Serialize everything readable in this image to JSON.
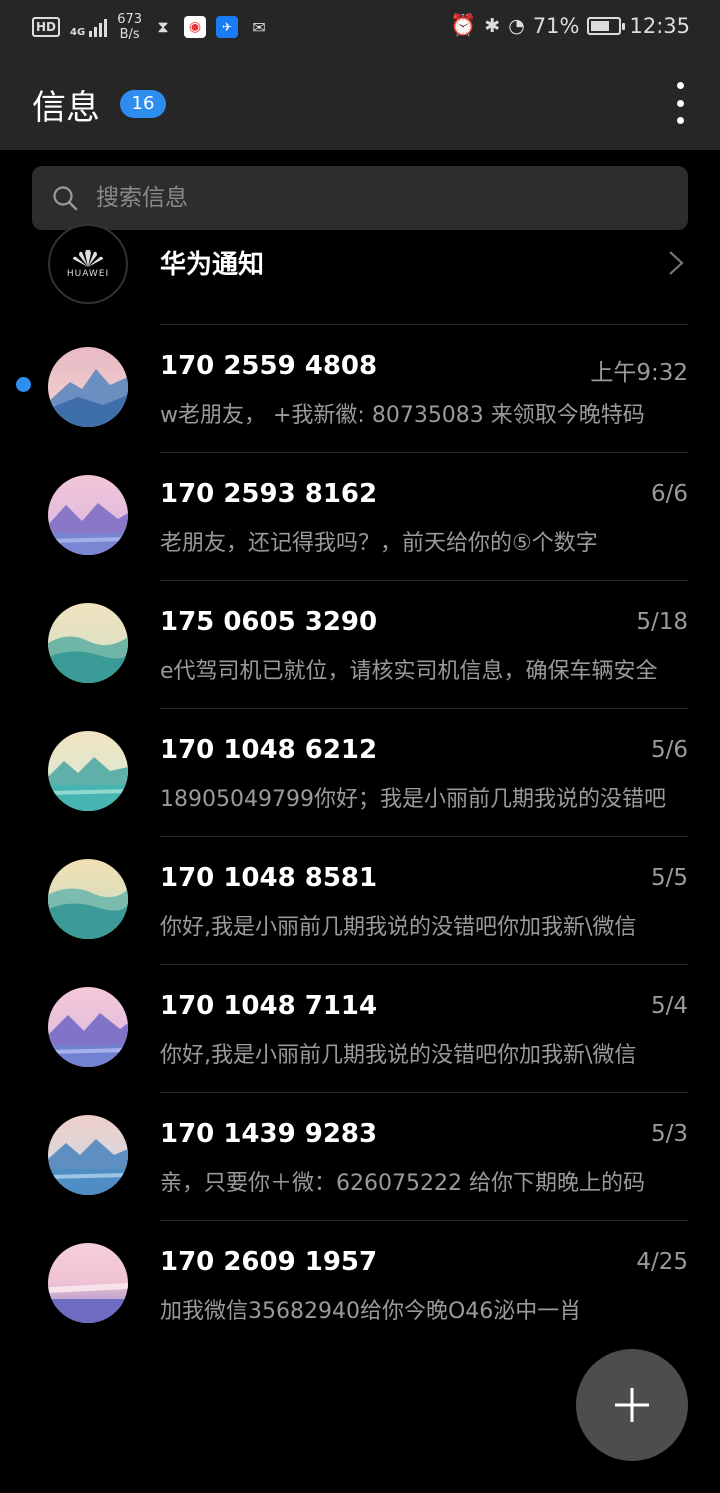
{
  "status_bar": {
    "hd": "HD",
    "network": "4G",
    "speed_value": "673",
    "speed_unit": "B/s",
    "battery": "71%",
    "battery_level": 0.71,
    "time": "12:35"
  },
  "header": {
    "title": "信息",
    "unread_count": "16",
    "more_icon": "more-vertical-icon"
  },
  "search": {
    "placeholder": "搜索信息"
  },
  "notification": {
    "logo_text": "HUAWEI",
    "title": "华为通知"
  },
  "conversations": [
    {
      "sender": "170 2559 4808",
      "time": "上午9:32",
      "preview": "w老朋友， +我新徽:  80735083 来领取今晚特码",
      "unread": true,
      "avatar": "mountain-pink"
    },
    {
      "sender": "170 2593 8162",
      "time": "6/6",
      "preview": "老朋友，还记得我吗？，前天给你的⑤个数字",
      "unread": false,
      "avatar": "lake-purple"
    },
    {
      "sender": "175 0605 3290",
      "time": "5/18",
      "preview": "e代驾司机已就位，请核实司机信息，确保车辆安全",
      "unread": false,
      "avatar": "hills-teal"
    },
    {
      "sender": "170 1048 6212",
      "time": "5/6",
      "preview": "18905049799你好；我是小丽前几期我说的没错吧",
      "unread": false,
      "avatar": "lake-teal"
    },
    {
      "sender": "170 1048 8581",
      "time": "5/5",
      "preview": "你好,我是小丽前几期我说的没错吧你加我新\\微信",
      "unread": false,
      "avatar": "hills-teal-2"
    },
    {
      "sender": "170 1048 7114",
      "time": "5/4",
      "preview": "你好,我是小丽前几期我说的没错吧你加我新\\微信",
      "unread": false,
      "avatar": "lake-purple-2"
    },
    {
      "sender": "170 1439 9283",
      "time": "5/3",
      "preview": "亲，只要你＋微：626075222 给你下期晚上的码",
      "unread": false,
      "avatar": "lake-blue"
    },
    {
      "sender": "170 2609 1957",
      "time": "4/25",
      "preview": "加我微信35682940给你今晚O46泌中一肖",
      "unread": false,
      "avatar": "sea-pink"
    }
  ],
  "fab": {
    "icon": "plus-icon"
  },
  "colors": {
    "accent": "#2e8ef0",
    "background": "#000000",
    "bar": "#262626"
  }
}
